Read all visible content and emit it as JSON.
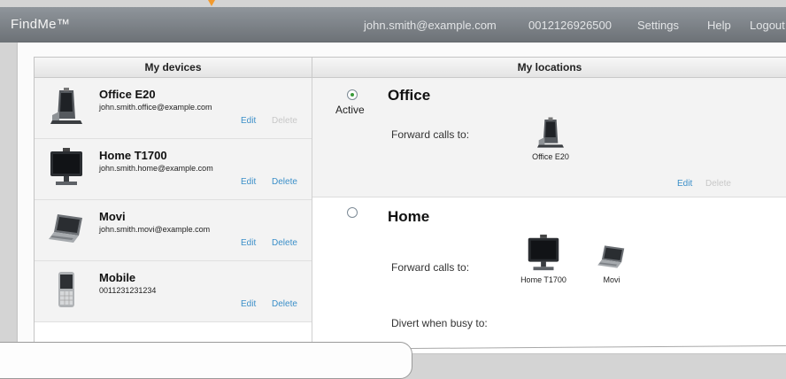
{
  "header": {
    "brand": "FindMe™",
    "email": "john.smith@example.com",
    "number": "0012126926500",
    "settings_label": "Settings",
    "help_label": "Help",
    "logout_label": "Logout"
  },
  "devices": {
    "heading": "My devices",
    "edit_label": "Edit",
    "delete_label": "Delete",
    "items": [
      {
        "name": "Office E20",
        "address": "john.smith.office@example.com",
        "icon": "desk-videophone-icon",
        "delete_enabled": false
      },
      {
        "name": "Home T1700",
        "address": "john.smith.home@example.com",
        "icon": "video-monitor-icon",
        "delete_enabled": true
      },
      {
        "name": "Movi",
        "address": "john.smith.movi@example.com",
        "icon": "laptop-icon",
        "delete_enabled": true
      },
      {
        "name": "Mobile",
        "address": "0011231231234",
        "icon": "mobile-phone-icon",
        "delete_enabled": true
      }
    ]
  },
  "locations": {
    "heading": "My locations",
    "items": [
      {
        "name": "Office",
        "active": true,
        "active_label": "Active",
        "forward_label": "Forward calls to:",
        "forward_targets": [
          "Office E20"
        ],
        "edit_label": "Edit",
        "delete_label": "Delete",
        "delete_enabled": false
      },
      {
        "name": "Home",
        "active": false,
        "forward_label": "Forward calls to:",
        "forward_targets": [
          "Home T1700",
          "Movi"
        ],
        "divert_label": "Divert when busy to:"
      }
    ]
  },
  "colors": {
    "header_bg": "#7d8287",
    "link": "#3b8fc9",
    "link_disabled": "#c8c8c8",
    "accent_marker": "#f29a2e",
    "radio_checked": "#3a9b3a"
  }
}
